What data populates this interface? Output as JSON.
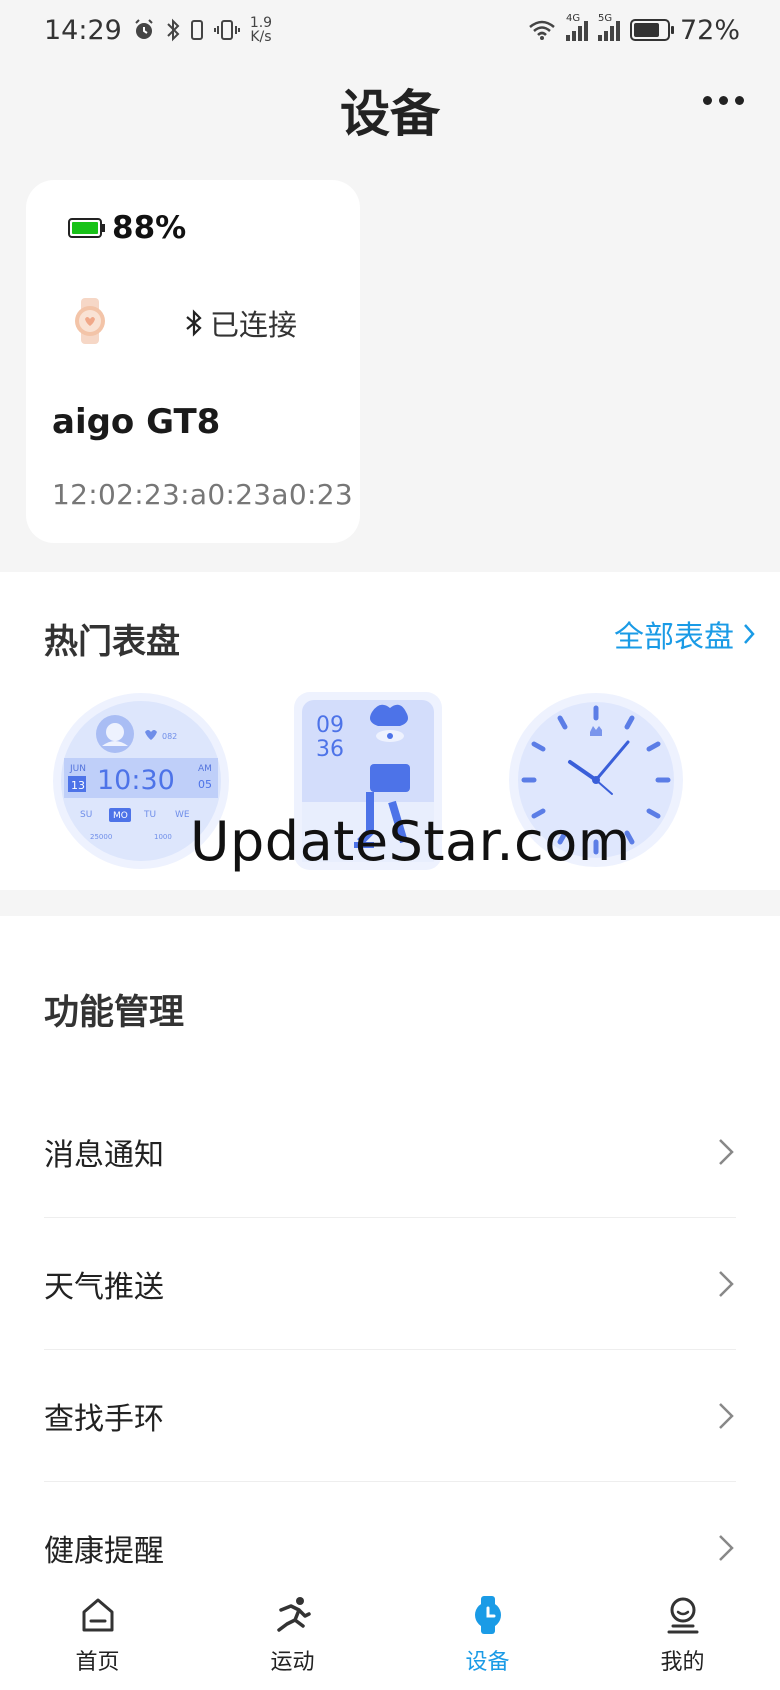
{
  "status_bar": {
    "time": "14:29",
    "net_speed_value": "1.9",
    "net_speed_unit": "K/s",
    "sim1_type": "4G",
    "sim2_type": "5G",
    "battery_percent": "72%",
    "icons": [
      "alarm-icon",
      "bluetooth-icon",
      "vibrate-icon",
      "wifi-icon",
      "signal-icon",
      "battery-charging-icon"
    ]
  },
  "header": {
    "title": "设备",
    "more_icon": "more-dots-icon"
  },
  "device_card": {
    "battery_percent": "88%",
    "battery_level": 0.88,
    "battery_color": "#19c219",
    "connection_status": "已连接",
    "device_name": "aigo GT8",
    "mac_address": "12:02:23:a0:23a0:23"
  },
  "watch_faces": {
    "title": "热门表盘",
    "all_label": "全部表盘",
    "watermark": "UpdateStar.com",
    "face1": {
      "month": "JUN",
      "day": "13",
      "time": "10:30",
      "ampm": "AM",
      "date_num": "05",
      "heart": "082",
      "weekdays": [
        "SU",
        "MO",
        "TU",
        "WE"
      ],
      "steps": "25000",
      "calories": "1000"
    },
    "face2": {
      "hour": "09",
      "minute": "36"
    }
  },
  "functions": {
    "title": "功能管理",
    "items": [
      {
        "label": "消息通知"
      },
      {
        "label": "天气推送"
      },
      {
        "label": "查找手环"
      },
      {
        "label": "健康提醒"
      }
    ]
  },
  "bottom_nav": {
    "items": [
      {
        "label": "首页",
        "icon": "home-icon"
      },
      {
        "label": "运动",
        "icon": "running-icon"
      },
      {
        "label": "设备",
        "icon": "watch-icon",
        "active": true
      },
      {
        "label": "我的",
        "icon": "profile-icon"
      }
    ]
  },
  "colors": {
    "accent": "#1a9be6",
    "background": "#f5f5f5",
    "card": "#ffffff",
    "face_blue": "#4d73e8"
  }
}
